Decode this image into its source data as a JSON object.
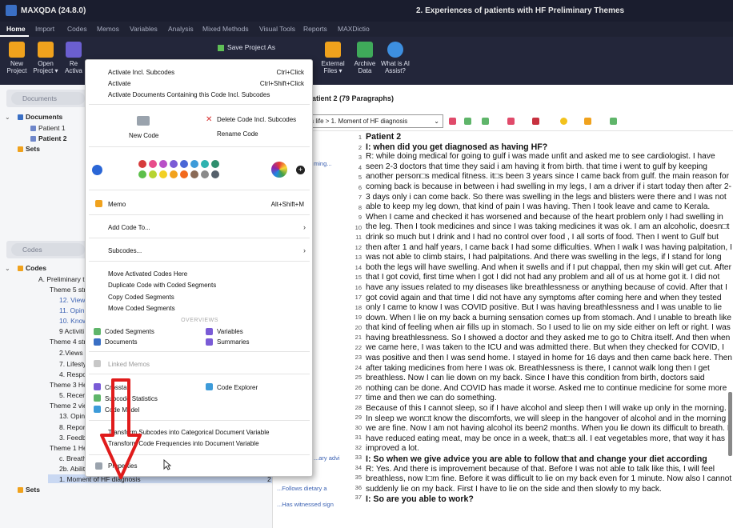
{
  "window": {
    "app": "MAXQDA (24.8.0)",
    "doc_title": "2. Experiences of patients with HF Preliminary Themes"
  },
  "menu_tabs": [
    "Home",
    "Import",
    "Codes",
    "Memos",
    "Variables",
    "Analysis",
    "Mixed Methods",
    "Visual Tools",
    "Reports",
    "MAXDictio"
  ],
  "ribbon": {
    "new_project": "New\nProject",
    "open_project": "Open\nProject ▾",
    "re": "Re\nActiva",
    "save_as": "Save Project As",
    "external_files": "External\nFiles ▾",
    "archive_data": "Archive\nData",
    "what_is_ai": "What is AI\nAssist?"
  },
  "documents_panel": {
    "search_placeholder": "Documents",
    "root": "Documents",
    "items": [
      "Patient 1",
      "Patient 2"
    ],
    "sets": "Sets"
  },
  "codes_panel": {
    "search_placeholder": "Codes",
    "root": "Codes",
    "rows": [
      "A. Preliminary th",
      "Theme 5 strat",
      "12. Views",
      "11. Opini",
      "10. Know",
      "9 Activiti",
      "Theme 4 strat",
      "2.Views o",
      "7. Lifestyl",
      "4. Respor",
      "Theme 3 Hea",
      "5. Recent",
      "Theme 2 view",
      "13. Opinio",
      "8. Reporte",
      "3. Feedba",
      "Theme 1 Hea",
      "c. Breath",
      "2b. Ability",
      "1. Moment of HF diagnosis"
    ],
    "selected_count": "2",
    "sets": "Sets"
  },
  "mid_segments": [
    "ming...",
    "...ary advi",
    "...Follows dietary a",
    "...Has witnessed sign"
  ],
  "doc": {
    "header": "Patient 2  (79 Paragraphs)",
    "breadcrumb": "atient's life  >  1. Moment of HF diagnosis",
    "lines": [
      "1",
      "2",
      "3",
      "4",
      "5",
      "6",
      "7",
      "8",
      "9",
      "10",
      "11",
      "12",
      "13",
      "14",
      "15",
      "16",
      "17",
      "18",
      "19",
      "20",
      "21",
      "22",
      "23",
      "24",
      "25",
      "26",
      "27",
      "28",
      "29",
      "30",
      "31",
      "32",
      "33",
      "34",
      "35",
      "36",
      "37"
    ],
    "text": [
      {
        "h": true,
        "t": "Patient 2"
      },
      {
        "h": true,
        "t": "I: when did you get diagnosed as having HF?"
      },
      {
        "h": false,
        "t": "R: while doing medical for going to gulf i was made unfit and asked me to see cardiologist. I have seen 2-3 doctors that time they said i am having it from birth. that time i went to gulf by keeping another person□s medical fitness. it□s been 3 years since I came back from gulf. the main reason for coming back is because in between i had swelling in my legs, I am a driver if i start today then after 2-3 days only i can come back. So there was swelling in the legs and blisters were there and I was not able to keep my leg down, that kind of pain I was having. Then I took leave and came to Kerala. When I came and checked it has worsened and because of the heart problem only I had swelling in the leg. Then I took medicines and since I was taking medicines it was ok. I am an alcoholic, doesn□t drink so much but I drink and I had no control over food , I all sorts of food. Then I went to Gulf but then after 1 and half years, I came back I had some difficulties. When I walk I was having palpitation, I was not able to climb stairs, I had palpitations. And there was swelling in the legs, if I stand for long both the legs will have swelling. And when it swells and if I put chappal, then my skin will get cut. After that I got covid, first time when I got I did not had any problem and all of us at home got it. I did not have any issues related to my diseases like breathlessness or anything because of covid. After that I got covid again and that time I did not have any symptoms after coming here and when they tested only I came to know I was COVID positive. But I was having breathlessness and I was unable to lie down. When I lie on my back a burning sensation comes up from stomach. And I unable to breath like that kind of feeling when air fills up in stomach. So I used to lie on my side either on left or right. I was having breathlessness. So I showed a doctor and they asked me to go to Chitra itself. And then when we came here, I was taken to the ICU and was admitted there. But when they checked for COVID, I was positive and then I was send home. I stayed in home for 16 days and then came back here. Then after taking medicines from here I was ok. Breathlessness is there, I cannot walk long then I get breathless. Now I can lie down on my back. Since I have this condition from birth, doctors said nothing can be done. And COVID has made it worse. Asked me to continue medicine for some more time and then we can do something."
      },
      {
        "h": false,
        "t": "Because of this I cannot sleep, so if I have alcohol and sleep then I will wake up only in the morning. In sleep we won□t know the discomforts, we will sleep in the hangover of alcohol and in the morning we are fine. Now I am not having alcohol its been2 months. When you lie down its difficult to breath. I have reduced eating meat, may be once in a week, that□s all. I eat vegetables more, that way it has improved a lot."
      },
      {
        "h": true,
        "t": "I: So when we give advice you are able to follow that and change your diet according"
      },
      {
        "h": false,
        "t": "R: Yes. And there is improvement because of that. Before I was not able to talk like this, I will feel breathless, now I□m fine. Before it was difficult to lie on my back even for 1 minute. Now also I cannot suddenly lie on my back. First I have to lie on the side and then slowly to my back."
      },
      {
        "h": true,
        "t": "I: So are you able to work?"
      }
    ]
  },
  "context_menu": {
    "activate_incl": "Activate Incl. Subcodes",
    "activate_incl_sc": "Ctrl+Click",
    "activate": "Activate",
    "activate_sc": "Ctrl+Shift+Click",
    "activate_docs": "Activate Documents Containing this Code Incl. Subcodes",
    "new_code": "New Code",
    "delete_code": "Delete Code Incl. Subcodes",
    "rename_code": "Rename Code",
    "memo": "Memo",
    "memo_sc": "Alt+Shift+M",
    "add_code_to": "Add Code To...",
    "subcodes": "Subcodes...",
    "move_here": "Move Activated Codes Here",
    "duplicate": "Duplicate Code with Coded Segments",
    "copy_segments": "Copy Coded Segments",
    "move_segments": "Move Coded Segments",
    "overviews": "OVERVIEWS",
    "ov_coded": "Coded Segments",
    "ov_variables": "Variables",
    "ov_documents": "Documents",
    "ov_summaries": "Summaries",
    "linked_memos": "Linked Memos",
    "crosstab": "Crosstab",
    "code_explorer": "Code Explorer",
    "subcode_stats": "Subcode Statistics",
    "code_model": "Code Model",
    "transform1": "Transform Subcodes into Categorical Document Variable",
    "transform2": "Transform Code Frequencies into Document Variable",
    "properties": "Properties",
    "colors": [
      "#d63b3b",
      "#e84c8b",
      "#b84fc7",
      "#7a5bd6",
      "#4a67d6",
      "#3d9bd9",
      "#2fb3b0",
      "#2f8f6e",
      "#5cbf4a",
      "#b7d431",
      "#f2d024",
      "#f2a21d",
      "#f26a1d",
      "#8a6a56",
      "#8a8a8a",
      "#55606b"
    ]
  },
  "icon_colors": {
    "accent": "#3a6fc4",
    "selected_dot": "#2a66d6",
    "arrow": "#e01b1b"
  }
}
